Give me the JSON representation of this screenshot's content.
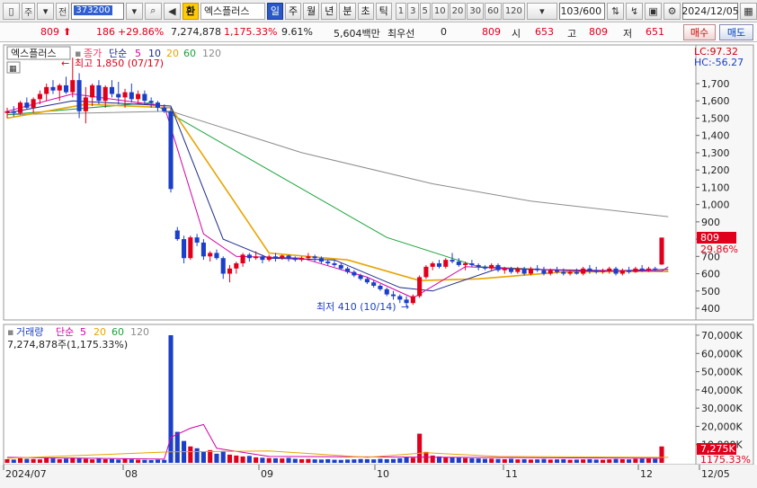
{
  "toolbar": {
    "market": "주",
    "mode": "전",
    "code": "373200",
    "fav_label": "환",
    "stock_name": "엑스플러스",
    "periods": [
      {
        "label": "일",
        "active": true
      },
      {
        "label": "주",
        "active": false
      },
      {
        "label": "월",
        "active": false
      },
      {
        "label": "년",
        "active": false
      },
      {
        "label": "분",
        "active": false
      },
      {
        "label": "초",
        "active": false
      },
      {
        "label": "틱",
        "active": false
      }
    ],
    "intervals": [
      "1",
      "3",
      "5",
      "10",
      "20",
      "30",
      "60",
      "120"
    ],
    "count": "103/600",
    "date": "2024/12/05"
  },
  "quote": {
    "price": "809",
    "change": "186",
    "change_pct": "+29.86%",
    "volume": "7,274,878",
    "volume_ratio": "1,175.33%",
    "turnover": "9.61%",
    "amount": "5,604백만",
    "best_bid_label": "최우선",
    "best_bid": "0",
    "best_ask": "809",
    "open_label": "시",
    "open": "653",
    "high_label": "고",
    "high": "809",
    "low_label": "저",
    "low": "651",
    "buy_label": "매수",
    "sell_label": "매도"
  },
  "colors": {
    "up": "#e0001b",
    "down": "#1c3fc9",
    "ma5": "#d400a6",
    "ma10": "#1c2a8a",
    "ma20": "#e8a400",
    "ma60": "#1aa33a",
    "ma120": "#8c8c8c",
    "close_line": "#ff3366"
  },
  "price_panel": {
    "stock_tag": "엑스플러스",
    "legend_close": "종가",
    "legend_ma": "단순",
    "legend_periods": [
      "5",
      "10",
      "20",
      "60",
      "120"
    ],
    "lc": "LC:97.32",
    "hc": "HC:-56.27",
    "high_annotation": "최고 1,850 (07/17)",
    "low_annotation": "최저 410 (10/14)",
    "current_label": "809",
    "current_pct": "29.86%",
    "y_ticks": [
      "1,700",
      "1,600",
      "1,500",
      "1,400",
      "1,300",
      "1,200",
      "1,100",
      "1,000",
      "900",
      "800",
      "700",
      "600",
      "500",
      "400"
    ]
  },
  "volume_panel": {
    "legend_title": "거래량",
    "legend_ma": "단순",
    "legend_periods": [
      "5",
      "20",
      "60",
      "120"
    ],
    "summary": "7,274,878주(1,175.33%)",
    "y_ticks": [
      "70,000K",
      "60,000K",
      "50,000K",
      "40,000K",
      "30,000K",
      "20,000K",
      "10,000K"
    ],
    "current_label": "7,275K",
    "current_pct": "1175.33%"
  },
  "x_axis": [
    "2024/07",
    "08",
    "09",
    "10",
    "11",
    "12",
    "12/05"
  ],
  "chart_data": {
    "type": "candlestick",
    "x_months": [
      "2024/07",
      "08",
      "09",
      "10",
      "11",
      "12"
    ],
    "last_date": "12/05",
    "ylim": [
      350,
      1850
    ],
    "candles": [
      [
        1530,
        1560,
        1500,
        1540
      ],
      [
        1540,
        1570,
        1510,
        1530
      ],
      [
        1530,
        1600,
        1520,
        1590
      ],
      [
        1590,
        1620,
        1550,
        1560
      ],
      [
        1560,
        1620,
        1530,
        1610
      ],
      [
        1610,
        1660,
        1580,
        1640
      ],
      [
        1640,
        1700,
        1600,
        1680
      ],
      [
        1680,
        1720,
        1640,
        1660
      ],
      [
        1660,
        1700,
        1600,
        1690
      ],
      [
        1690,
        1740,
        1640,
        1650
      ],
      [
        1650,
        1850,
        1620,
        1720
      ],
      [
        1720,
        1760,
        1500,
        1540
      ],
      [
        1540,
        1680,
        1470,
        1620
      ],
      [
        1620,
        1700,
        1570,
        1690
      ],
      [
        1690,
        1720,
        1580,
        1600
      ],
      [
        1600,
        1690,
        1560,
        1680
      ],
      [
        1680,
        1720,
        1620,
        1640
      ],
      [
        1640,
        1710,
        1580,
        1620
      ],
      [
        1620,
        1670,
        1560,
        1650
      ],
      [
        1650,
        1700,
        1590,
        1610
      ],
      [
        1610,
        1660,
        1580,
        1640
      ],
      [
        1640,
        1660,
        1580,
        1600
      ],
      [
        1600,
        1620,
        1560,
        1590
      ],
      [
        1590,
        1600,
        1540,
        1560
      ],
      [
        1560,
        1580,
        1530,
        1540
      ],
      [
        1540,
        1560,
        1070,
        1090
      ],
      [
        850,
        870,
        790,
        800
      ],
      [
        800,
        820,
        660,
        690
      ],
      [
        690,
        820,
        680,
        810
      ],
      [
        810,
        830,
        760,
        780
      ],
      [
        780,
        800,
        680,
        700
      ],
      [
        700,
        730,
        670,
        720
      ],
      [
        720,
        740,
        680,
        690
      ],
      [
        690,
        700,
        570,
        600
      ],
      [
        600,
        650,
        550,
        630
      ],
      [
        630,
        670,
        600,
        660
      ],
      [
        660,
        720,
        640,
        710
      ],
      [
        710,
        720,
        670,
        690
      ],
      [
        690,
        730,
        680,
        700
      ],
      [
        700,
        710,
        660,
        680
      ],
      [
        680,
        710,
        670,
        700
      ],
      [
        700,
        720,
        670,
        690
      ],
      [
        690,
        710,
        680,
        705
      ],
      [
        705,
        710,
        670,
        690
      ],
      [
        690,
        700,
        670,
        680
      ],
      [
        680,
        700,
        670,
        690
      ],
      [
        690,
        720,
        680,
        700
      ],
      [
        700,
        710,
        670,
        690
      ],
      [
        690,
        700,
        660,
        670
      ],
      [
        670,
        680,
        650,
        660
      ],
      [
        660,
        680,
        640,
        650
      ],
      [
        650,
        660,
        620,
        630
      ],
      [
        630,
        640,
        600,
        610
      ],
      [
        610,
        620,
        580,
        590
      ],
      [
        590,
        600,
        560,
        570
      ],
      [
        570,
        580,
        540,
        550
      ],
      [
        550,
        560,
        520,
        530
      ],
      [
        530,
        540,
        500,
        510
      ],
      [
        510,
        520,
        470,
        480
      ],
      [
        480,
        500,
        450,
        470
      ],
      [
        470,
        480,
        430,
        450
      ],
      [
        450,
        470,
        410,
        430
      ],
      [
        430,
        480,
        420,
        470
      ],
      [
        470,
        590,
        460,
        580
      ],
      [
        580,
        650,
        570,
        640
      ],
      [
        640,
        670,
        620,
        660
      ],
      [
        660,
        680,
        630,
        640
      ],
      [
        640,
        690,
        630,
        680
      ],
      [
        680,
        720,
        660,
        670
      ],
      [
        670,
        690,
        640,
        650
      ],
      [
        650,
        670,
        620,
        660
      ],
      [
        660,
        680,
        640,
        650
      ],
      [
        650,
        660,
        620,
        640
      ],
      [
        640,
        650,
        620,
        630
      ],
      [
        630,
        660,
        620,
        650
      ],
      [
        650,
        660,
        610,
        620
      ],
      [
        620,
        640,
        600,
        630
      ],
      [
        630,
        640,
        600,
        610
      ],
      [
        610,
        640,
        600,
        630
      ],
      [
        630,
        640,
        590,
        600
      ],
      [
        600,
        640,
        590,
        630
      ],
      [
        630,
        650,
        610,
        620
      ],
      [
        620,
        640,
        590,
        600
      ],
      [
        600,
        630,
        590,
        620
      ],
      [
        620,
        640,
        600,
        610
      ],
      [
        610,
        630,
        590,
        600
      ],
      [
        600,
        620,
        590,
        610
      ],
      [
        610,
        630,
        595,
        600
      ],
      [
        600,
        640,
        590,
        630
      ],
      [
        630,
        650,
        600,
        620
      ],
      [
        620,
        640,
        600,
        610
      ],
      [
        610,
        630,
        600,
        615
      ],
      [
        615,
        640,
        600,
        630
      ],
      [
        630,
        640,
        590,
        600
      ],
      [
        600,
        630,
        590,
        620
      ],
      [
        620,
        640,
        600,
        610
      ],
      [
        610,
        640,
        605,
        630
      ],
      [
        630,
        650,
        610,
        620
      ],
      [
        620,
        640,
        610,
        630
      ],
      [
        630,
        640,
        615,
        623
      ],
      [
        653,
        809,
        651,
        809
      ]
    ],
    "ma": {
      "5": [
        [
          0,
          1540
        ],
        [
          10,
          1640
        ],
        [
          24,
          1570
        ],
        [
          30,
          830
        ],
        [
          35,
          700
        ],
        [
          45,
          690
        ],
        [
          55,
          580
        ],
        [
          62,
          460
        ],
        [
          70,
          640
        ],
        [
          80,
          625
        ],
        [
          100,
          615
        ],
        [
          101,
          640
        ]
      ],
      "10": [
        [
          0,
          1530
        ],
        [
          10,
          1600
        ],
        [
          25,
          1570
        ],
        [
          33,
          800
        ],
        [
          40,
          690
        ],
        [
          50,
          680
        ],
        [
          60,
          520
        ],
        [
          65,
          500
        ],
        [
          75,
          630
        ],
        [
          90,
          615
        ],
        [
          101,
          625
        ]
      ],
      "20": [
        [
          0,
          1500
        ],
        [
          12,
          1580
        ],
        [
          25,
          1560
        ],
        [
          40,
          720
        ],
        [
          52,
          680
        ],
        [
          63,
          560
        ],
        [
          72,
          570
        ],
        [
          85,
          610
        ],
        [
          101,
          615
        ]
      ],
      "60": [
        [
          0,
          1520
        ],
        [
          22,
          1590
        ],
        [
          40,
          1200
        ],
        [
          58,
          810
        ],
        [
          72,
          640
        ],
        [
          85,
          620
        ],
        [
          101,
          612
        ]
      ],
      "120": [
        [
          0,
          1520
        ],
        [
          25,
          1540
        ],
        [
          45,
          1300
        ],
        [
          65,
          1120
        ],
        [
          80,
          1020
        ],
        [
          101,
          930
        ]
      ]
    },
    "volume_k": [
      2000,
      1800,
      2500,
      2200,
      2100,
      1900,
      2600,
      2400,
      2000,
      2300,
      2800,
      2600,
      2200,
      1900,
      2400,
      2000,
      2100,
      1800,
      2300,
      1900,
      1700,
      1600,
      1500,
      1700,
      1600,
      70000,
      17000,
      12000,
      9000,
      8000,
      6000,
      7000,
      5000,
      6500,
      4500,
      4000,
      3500,
      3800,
      3000,
      2800,
      2600,
      2500,
      2400,
      2700,
      2200,
      2000,
      2100,
      1900,
      1800,
      2000,
      1700,
      1600,
      1800,
      1900,
      2100,
      2000,
      1900,
      2200,
      2000,
      2100,
      2500,
      3200,
      2800,
      16000,
      6000,
      4000,
      3500,
      3000,
      3200,
      2800,
      2600,
      2500,
      2400,
      2200,
      2300,
      2100,
      2000,
      2200,
      1900,
      2000,
      1800,
      1900,
      2100,
      1800,
      1900,
      2000,
      1700,
      1800,
      1900,
      2000,
      1800,
      1700,
      1900,
      2100,
      2000,
      1900,
      2200,
      2300,
      2400,
      2200,
      9000
    ],
    "volume_ma5": [
      [
        0,
        3000
      ],
      [
        24,
        2000
      ],
      [
        25,
        14000
      ],
      [
        28,
        19000
      ],
      [
        30,
        21000
      ],
      [
        32,
        8000
      ],
      [
        40,
        3500
      ],
      [
        100,
        2500
      ]
    ],
    "volume_ma20": [
      [
        0,
        2500
      ],
      [
        25,
        6000
      ],
      [
        40,
        6500
      ],
      [
        55,
        3000
      ],
      [
        64,
        5500
      ],
      [
        75,
        3500
      ],
      [
        101,
        3000
      ]
    ]
  }
}
